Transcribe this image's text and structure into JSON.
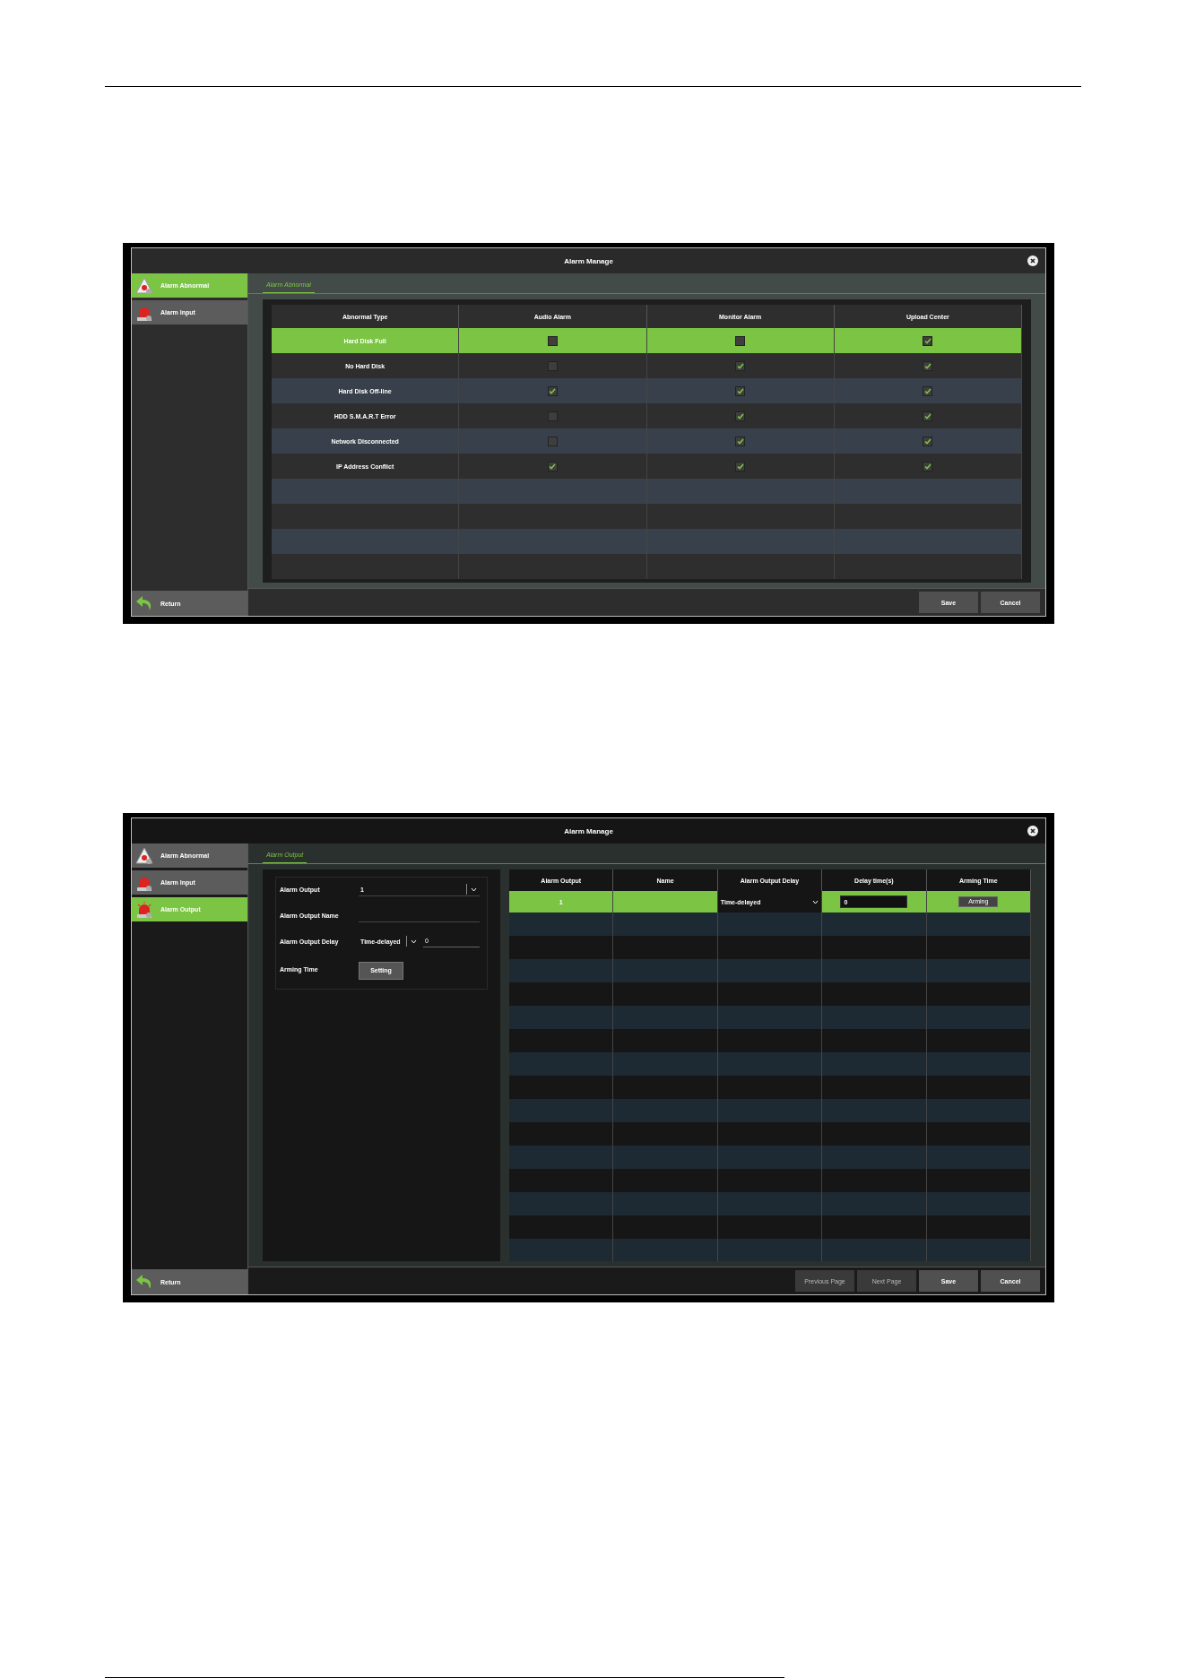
{
  "abnormal_screen": {
    "title": "Alarm Manage",
    "sidebar": [
      {
        "label": "Alarm Abnormal",
        "selected": true
      },
      {
        "label": "Alarm Input",
        "selected": false
      }
    ],
    "return_label": "Return",
    "section_tab": "Alarm Abnormal",
    "table": {
      "columns": [
        "Abnormal Type",
        "Audio Alarm",
        "Monitor Alarm",
        "Upload Center"
      ],
      "rows": [
        {
          "type": "Hard Disk Full",
          "audio_alarm": false,
          "monitor_alarm": false,
          "upload_center": true,
          "selected": true
        },
        {
          "type": "No Hard Disk",
          "audio_alarm": false,
          "monitor_alarm": true,
          "upload_center": true,
          "selected": false
        },
        {
          "type": "Hard Disk Off-line",
          "audio_alarm": true,
          "monitor_alarm": true,
          "upload_center": true,
          "selected": false
        },
        {
          "type": "HDD S.M.A.R.T Error",
          "audio_alarm": false,
          "monitor_alarm": true,
          "upload_center": true,
          "selected": false
        },
        {
          "type": "Network Disconnected",
          "audio_alarm": false,
          "monitor_alarm": true,
          "upload_center": true,
          "selected": false
        },
        {
          "type": "IP Address Conflict",
          "audio_alarm": true,
          "monitor_alarm": true,
          "upload_center": true,
          "selected": false
        }
      ]
    },
    "buttons": [
      {
        "label": "Save",
        "disabled": false
      },
      {
        "label": "Cancel",
        "disabled": false
      }
    ]
  },
  "output_screen": {
    "title": "Alarm Manage",
    "sidebar": [
      {
        "label": "Alarm Abnormal",
        "selected": false
      },
      {
        "label": "Alarm Input",
        "selected": false
      },
      {
        "label": "Alarm Output",
        "selected": true
      }
    ],
    "return_label": "Return",
    "section_tab": "Alarm Output",
    "form": {
      "alarm_output_label": "Alarm Output",
      "alarm_output_value": "1",
      "name_label": "Alarm Output Name",
      "delay_label": "Alarm Output Delay",
      "delay_mode": "Time-delayed",
      "delay_value": "0",
      "arming_label": "Arming Time",
      "setting_button": "Setting"
    },
    "table": {
      "columns": [
        "Alarm Output",
        "Name",
        "Alarm Output Delay",
        "Delay time(s)",
        "Arming Time"
      ],
      "rows": [
        {
          "output": "1",
          "delay_mode": "Time-delayed",
          "delay_value": "0",
          "arming_button": "Arming",
          "selected": true
        }
      ]
    },
    "buttons": [
      {
        "label": "Previous Page",
        "disabled": true
      },
      {
        "label": "Next Page",
        "disabled": true
      },
      {
        "label": "Save",
        "disabled": false
      },
      {
        "label": "Cancel",
        "disabled": false
      }
    ]
  }
}
